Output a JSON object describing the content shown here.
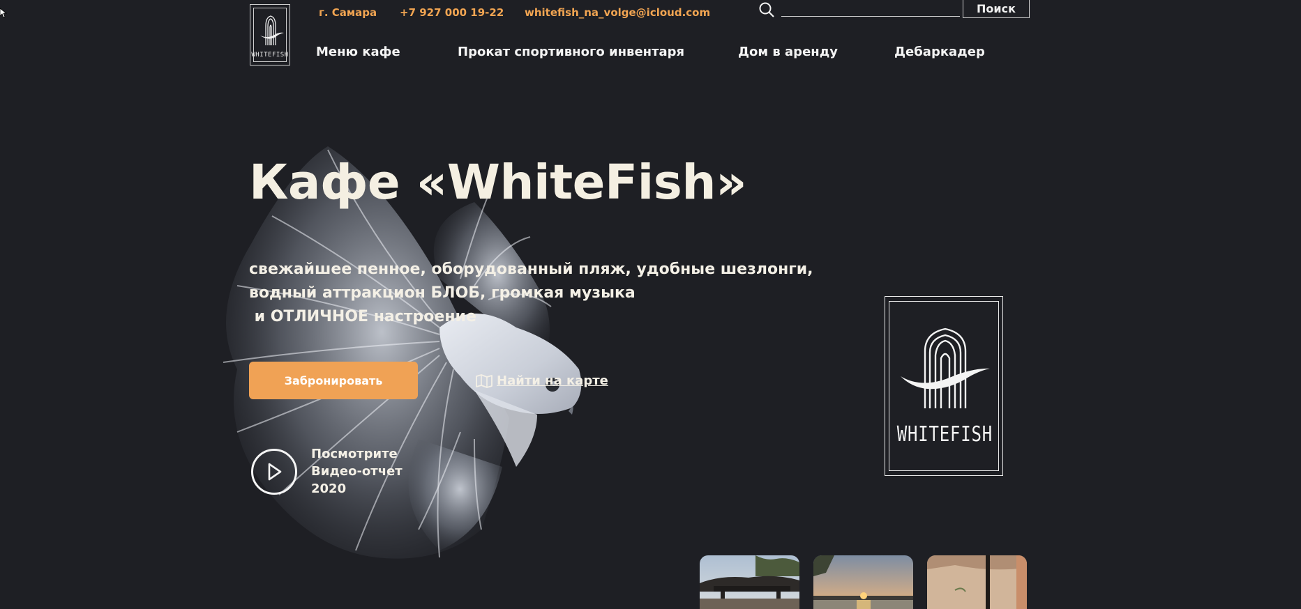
{
  "header": {
    "logo_text": "WHITEFISH",
    "city": "г. Самара",
    "phone": "+7 927 000 19-22",
    "email": "whitefish_na_volge@icloud.com",
    "search": {
      "placeholder": "",
      "button_label": "Поиск"
    },
    "nav": [
      {
        "label": "Меню кафе"
      },
      {
        "label": "Прокат спортивного инвентаря"
      },
      {
        "label": "Дом в аренду"
      },
      {
        "label": "Дебаркадер"
      }
    ]
  },
  "hero": {
    "title": "Кафе «WhiteFish»",
    "description_lines": [
      "свежайшее пенное, оборудованный пляж, удобные шезлонги,",
      "водный аттракцион БЛОБ, громкая музыка",
      " и ОТЛИЧНОЕ настроение"
    ],
    "book_button": "Забронировать",
    "map_link": "Найти на карте",
    "video_lines": [
      "Посмотрите",
      "Видео-отчет",
      "2020"
    ]
  },
  "brand_logo": {
    "text": "WHITEFISH"
  },
  "gallery": {
    "thumbnails": [
      "beach-canopy",
      "sunset-river",
      "sandy-beach"
    ]
  },
  "colors": {
    "background": "#1e1f24",
    "accent": "#f0a255",
    "contact_text": "#f2a552",
    "text": "#f4f0e6"
  },
  "icons": {
    "search": "search-icon",
    "map": "map-icon",
    "play": "play-icon"
  }
}
